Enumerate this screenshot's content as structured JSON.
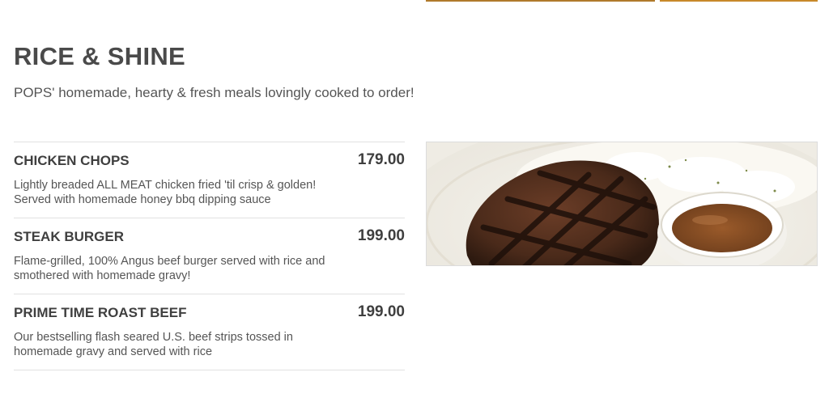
{
  "section": {
    "title": "RICE & SHINE",
    "subtitle": "POPS' homemade, hearty & fresh meals lovingly cooked to order!"
  },
  "menu": {
    "items": [
      {
        "name": "CHICKEN CHOPS",
        "price": "179.00",
        "desc_line1": "Lightly breaded ALL MEAT chicken fried 'til crisp & golden!",
        "desc_line2": "Served with homemade honey bbq dipping sauce"
      },
      {
        "name": "STEAK BURGER",
        "price": "199.00",
        "desc_line1": "Flame-grilled, 100% Angus beef burger served with rice and",
        "desc_line2": "smothered with homemade gravy!"
      },
      {
        "name": "PRIME TIME ROAST BEEF",
        "price": "199.00",
        "desc_line1": "Our bestselling flash seared U.S. beef strips tossed in",
        "desc_line2": "homemade gravy and served with rice"
      }
    ]
  }
}
